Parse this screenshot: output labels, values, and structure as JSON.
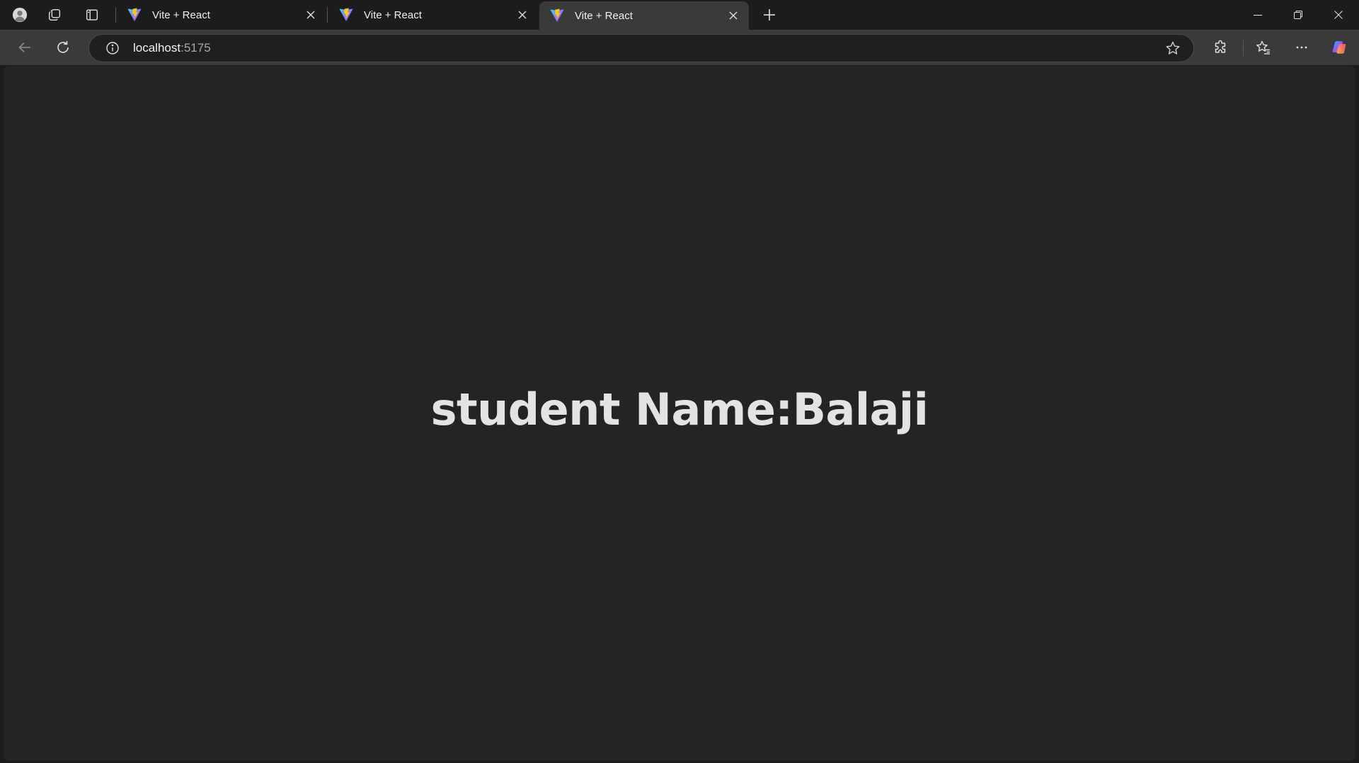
{
  "browser": {
    "tabs": [
      {
        "title": "Vite + React",
        "active": false
      },
      {
        "title": "Vite + React",
        "active": false
      },
      {
        "title": "Vite + React",
        "active": true
      }
    ],
    "address": {
      "host": "localhost",
      "port": ":5175"
    },
    "icons": {
      "profile": "profile-avatar-icon",
      "workspaces": "workspaces-icon",
      "vertical_tabs": "vertical-tabs-icon",
      "favicon": "vite-logo-icon",
      "close": "close-icon",
      "new_tab": "plus-icon",
      "back": "back-arrow-icon",
      "reload": "reload-icon",
      "site_info": "info-icon",
      "favorite": "star-icon",
      "extensions": "puzzle-icon",
      "favorites": "favorites-icon",
      "more": "more-icon",
      "copilot": "copilot-icon"
    },
    "colors": {
      "frame": "#1c1c1c",
      "toolbar": "#3a3a3a",
      "page_background": "#242424",
      "text": "#e3e3e3"
    }
  },
  "page": {
    "heading": "student Name:Balaji"
  }
}
